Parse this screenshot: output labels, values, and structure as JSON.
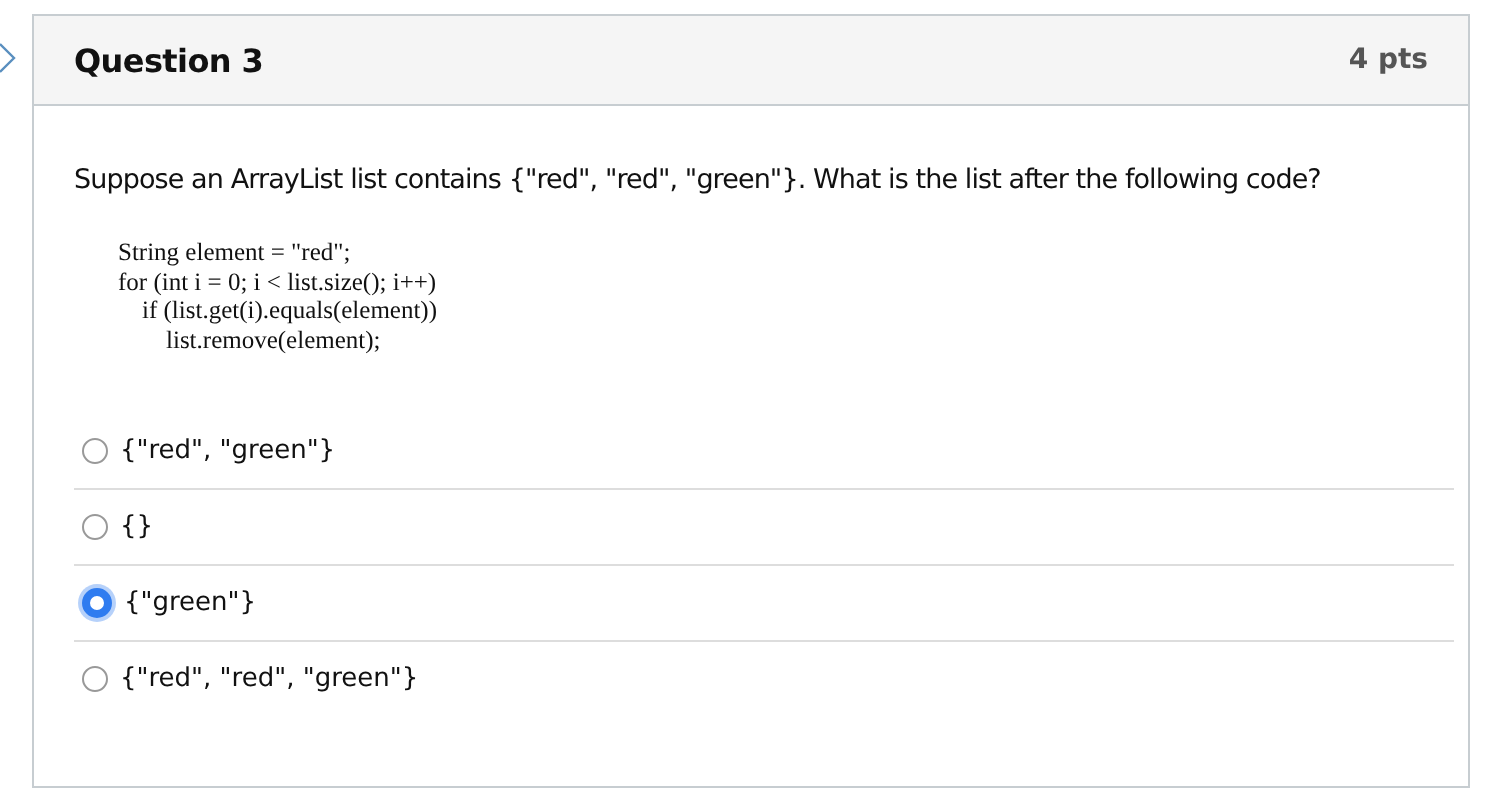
{
  "question": {
    "title": "Question 3",
    "points": "4 pts",
    "prompt": "Suppose an ArrayList list contains {\"red\", \"red\", \"green\"}. What is the list after the following code?",
    "code": [
      {
        "text": "String element = \"red\";"
      },
      {
        "text": "for (int i = 0; i < list.size(); i++)",
        "children": [
          {
            "text": "if (list.get(i).equals(element))",
            "children": [
              {
                "text": "list.remove(element);"
              }
            ]
          }
        ]
      }
    ],
    "answers": [
      {
        "label": "{\"red\", \"green\"}",
        "selected": false
      },
      {
        "label": "{}",
        "selected": false
      },
      {
        "label": "{\"green\"}",
        "selected": true
      },
      {
        "label": "{\"red\", \"red\", \"green\"}",
        "selected": false
      }
    ]
  }
}
